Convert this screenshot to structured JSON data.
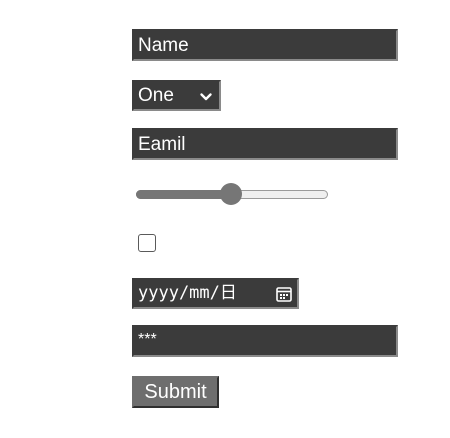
{
  "form": {
    "name_placeholder": "Name",
    "select_value": "One",
    "email_placeholder": "Eamil",
    "slider_value": 50,
    "slider_min": 0,
    "slider_max": 100,
    "checkbox_checked": false,
    "date_placeholder": "yyyy/mm/日",
    "password_value": "***",
    "submit_label": "Submit"
  },
  "icons": {
    "select": "chevron-down-icon",
    "date": "calendar-icon"
  },
  "colors": {
    "field_bg": "#3b3b3b",
    "field_text": "#ffffff",
    "button_bg": "#6e6e6e",
    "slider_fill": "#767676"
  }
}
